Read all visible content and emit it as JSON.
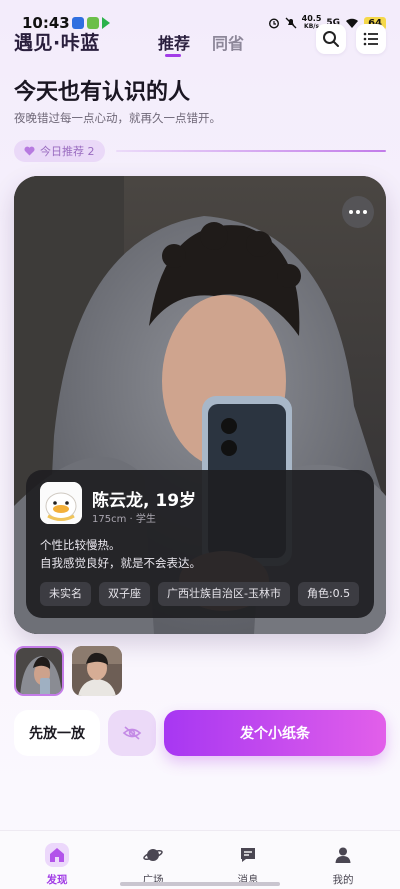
{
  "status_bar": {
    "time": "10:43",
    "net_speed_value": "40.5",
    "net_speed_unit": "KB/s",
    "signal": "5G",
    "battery": "64"
  },
  "header": {
    "logo": "遇见·咔蓝",
    "tabs": [
      {
        "label": "推荐",
        "active": true
      },
      {
        "label": "同省",
        "active": false
      }
    ],
    "search_icon": "search-icon",
    "menu_icon": "menu-icon"
  },
  "intro": {
    "title": "今天也有认识的人",
    "subtitle": "夜晚错过每一点心动，就再久一点错开。",
    "pill_label": "今日推荐 2"
  },
  "profile": {
    "name_age": "陈云龙, 19岁",
    "meta": "175cm · 学生",
    "bio_lines": [
      "个性比较慢热。",
      "自我感觉良好，就是不会表达。"
    ],
    "tags": [
      "未实名",
      "双子座",
      "广西壮族自治区-玉林市",
      "角色:0.5"
    ]
  },
  "actions": {
    "skip_label": "先放一放",
    "hide_icon": "eye-off-icon",
    "send_label": "发个小纸条"
  },
  "bottom_nav": [
    {
      "label": "发现",
      "icon": "home-icon",
      "active": true
    },
    {
      "label": "广场",
      "icon": "planet-icon",
      "active": false
    },
    {
      "label": "消息",
      "icon": "message-icon",
      "active": false
    },
    {
      "label": "我的",
      "icon": "person-icon",
      "active": false
    }
  ],
  "colors": {
    "accent": "#a33ce8",
    "gradient_start": "#a737f2",
    "gradient_end": "#e25fea"
  }
}
